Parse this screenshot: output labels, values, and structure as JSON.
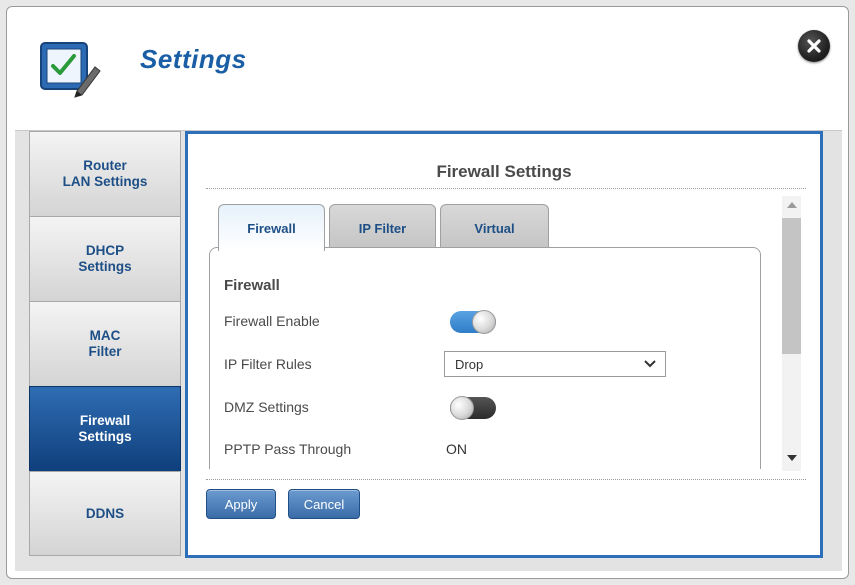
{
  "header": {
    "title": "Settings",
    "icon": "settings-checklist-icon",
    "close_icon": "close-icon"
  },
  "sidebar": {
    "items": [
      {
        "label": "Router\nLAN Settings",
        "active": false
      },
      {
        "label": "DHCP\nSettings",
        "active": false
      },
      {
        "label": "MAC\nFilter",
        "active": false
      },
      {
        "label": "Firewall\nSettings",
        "active": true
      },
      {
        "label": "DDNS",
        "active": false
      }
    ]
  },
  "panel": {
    "title": "Firewall Settings",
    "tabs": [
      {
        "label": "Firewall",
        "active": true
      },
      {
        "label": "IP Filter",
        "active": false
      },
      {
        "label": "Virtual",
        "active": false
      }
    ],
    "section_title": "Firewall",
    "rows": {
      "firewall_enable": {
        "label": "Firewall Enable",
        "state": "on"
      },
      "ip_filter_rules": {
        "label": "IP Filter Rules",
        "value": "Drop"
      },
      "dmz_settings": {
        "label": "DMZ Settings",
        "state": "off"
      },
      "pptp_pass_through": {
        "label": "PPTP Pass Through",
        "value": "ON"
      }
    }
  },
  "buttons": {
    "apply": "Apply",
    "cancel": "Cancel"
  },
  "colors": {
    "accent": "#2d6fb8",
    "title": "#1a5fa6",
    "active_nav": "#1a5296"
  }
}
